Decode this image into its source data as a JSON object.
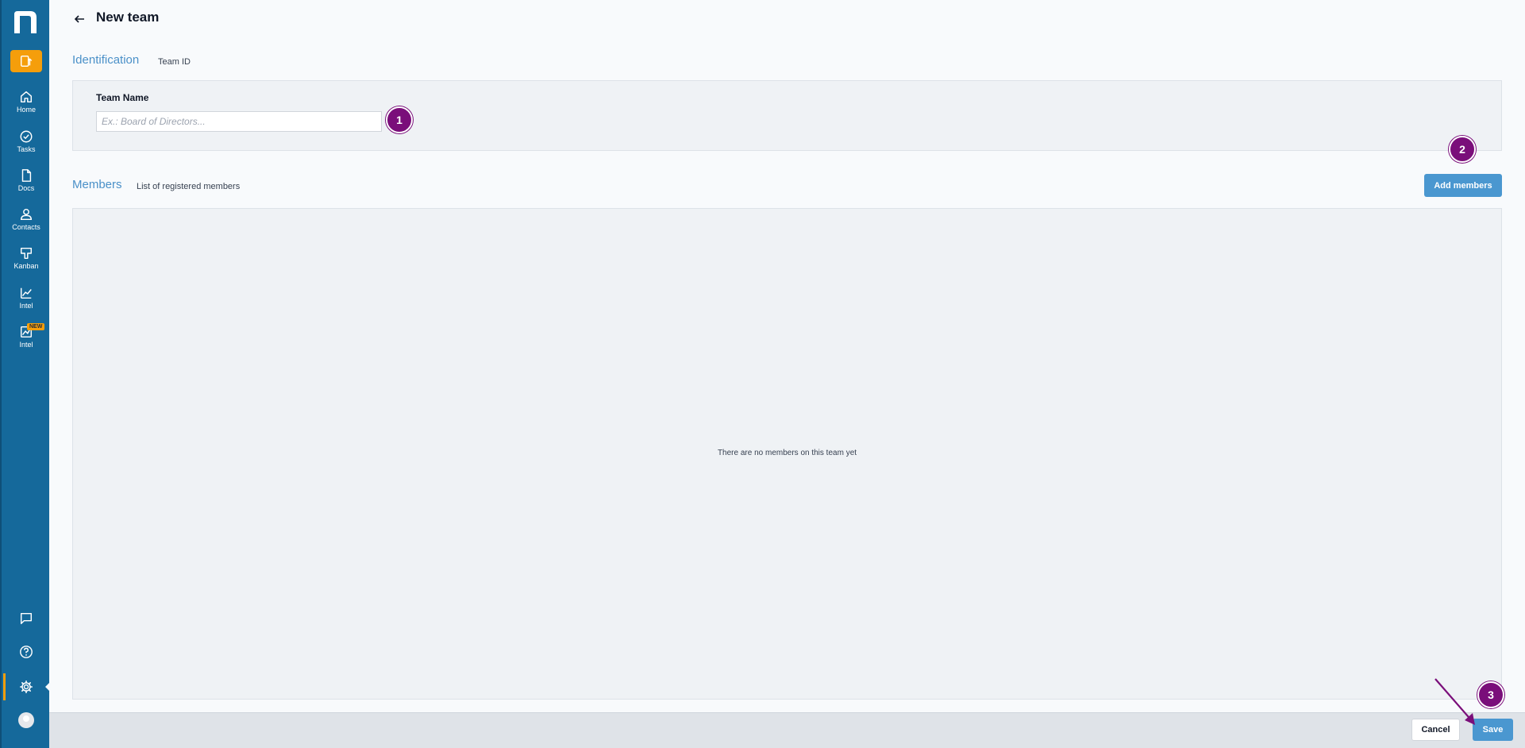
{
  "sidebar": {
    "logo": "n",
    "quick_action_icon": "device-upload-icon",
    "items": [
      {
        "label": "Home",
        "icon": "home-icon"
      },
      {
        "label": "Tasks",
        "icon": "check-circle-icon"
      },
      {
        "label": "Docs",
        "icon": "document-icon"
      },
      {
        "label": "Contacts",
        "icon": "user-icon"
      },
      {
        "label": "Kanban",
        "icon": "kanban-icon"
      },
      {
        "label": "Intel",
        "icon": "chart-line-icon"
      },
      {
        "label": "Intel",
        "icon": "chart-image-icon",
        "badge": "NEW"
      }
    ],
    "bottom": [
      "chat-icon",
      "help-icon",
      "gear-icon",
      "avatar"
    ]
  },
  "header": {
    "title": "New team"
  },
  "identification": {
    "title": "Identification",
    "subtitle": "Team ID",
    "team_name_label": "Team Name",
    "team_name_value": "",
    "team_name_placeholder": "Ex.: Board of Directors..."
  },
  "members": {
    "title": "Members",
    "subtitle": "List of registered members",
    "add_button": "Add members",
    "empty_text": "There are no members on this team yet"
  },
  "footer": {
    "cancel": "Cancel",
    "save": "Save"
  },
  "steps": [
    "1",
    "2",
    "3"
  ],
  "colors": {
    "sidebar": "#15699b",
    "accent": "#f59e0b",
    "primary_button": "#4a97d0",
    "section_title": "#4a90c8",
    "step_marker": "#7a0e7a"
  }
}
